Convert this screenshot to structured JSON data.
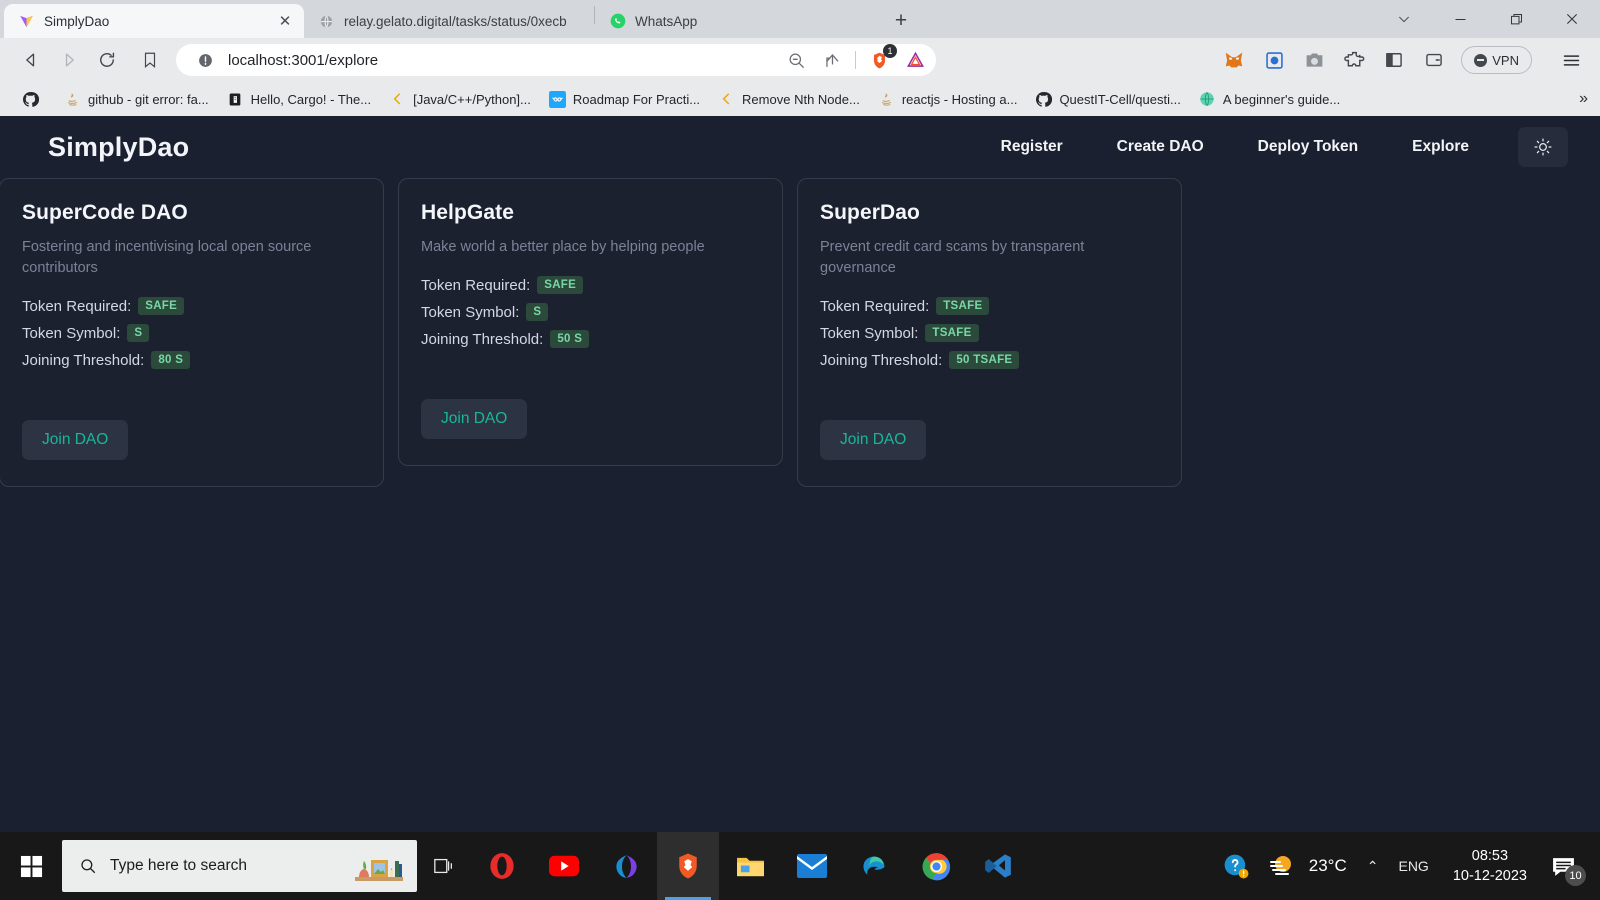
{
  "browser": {
    "tabs": [
      {
        "title": "SimplyDao",
        "icon": "vite-logo-icon",
        "active": true,
        "close_label": "✕"
      },
      {
        "title": "relay.gelato.digital/tasks/status/0xecb",
        "icon": "globe-icon",
        "active": false
      },
      {
        "title": "WhatsApp",
        "icon": "whatsapp-icon",
        "active": false
      }
    ],
    "new_tab_label": "+",
    "window_controls": {
      "tab_search": "⌄",
      "minimize": "—",
      "maximize": "❐",
      "close": "✕"
    },
    "toolbar": {
      "back": "back-arrow",
      "forward": "forward-arrow",
      "reload": "reload-arrow",
      "bookmark": "bookmark-icon",
      "url": "localhost:3001/explore",
      "site_info": "not-secure-icon",
      "zoom_out": "zoom-out-icon",
      "share": "share-icon",
      "brave_shields_count": "1",
      "vpn_label": "VPN",
      "menu": "hamburger-menu-icon"
    },
    "bookmarks": [
      {
        "label": "",
        "icon": "github-icon"
      },
      {
        "label": "github - git error: fa...",
        "icon": "java-icon"
      },
      {
        "label": "Hello, Cargo! - The...",
        "icon": "rust-book-icon"
      },
      {
        "label": "[Java/C++/Python]...",
        "icon": "leetcode-icon"
      },
      {
        "label": "Roadmap For Practi...",
        "icon": "infinity-icon"
      },
      {
        "label": "Remove Nth Node...",
        "icon": "leetcode-icon"
      },
      {
        "label": "reactjs - Hosting a...",
        "icon": "java-icon"
      },
      {
        "label": "QuestIT-Cell/questi...",
        "icon": "github-icon"
      },
      {
        "label": "A beginner's guide...",
        "icon": "globe-green-icon"
      }
    ],
    "bookmarks_overflow": "»"
  },
  "app": {
    "brand": "SimplyDao",
    "nav": [
      {
        "label": "Register"
      },
      {
        "label": "Create DAO"
      },
      {
        "label": "Deploy Token"
      },
      {
        "label": "Explore"
      }
    ],
    "theme_toggle_icon": "sun-icon",
    "labels": {
      "token_required": "Token Required:",
      "token_symbol": "Token Symbol:",
      "joining_threshold": "Joining Threshold:",
      "join_button": "Join DAO"
    },
    "cards": [
      {
        "title": "SuperCode DAO",
        "description": "Fostering and incentivising local open source contributors",
        "token_required": "SAFE",
        "token_symbol": "S",
        "joining_threshold": "80 S"
      },
      {
        "title": "HelpGate",
        "description": "Make world a better place by helping people",
        "token_required": "SAFE",
        "token_symbol": "S",
        "joining_threshold": "50 S"
      },
      {
        "title": "SuperDao",
        "description": "Prevent credit card scams by transparent governance",
        "token_required": "TSAFE",
        "token_symbol": "TSAFE",
        "joining_threshold": "50 TSAFE"
      }
    ]
  },
  "taskbar": {
    "start_icon": "windows-start-icon",
    "search_placeholder": "Type here to search",
    "search_icon": "search-icon",
    "task_view_icon": "task-view-icon",
    "apps": [
      {
        "name": "opera-icon",
        "active": false
      },
      {
        "name": "youtube-icon",
        "active": false
      },
      {
        "name": "microsoft-365-icon",
        "active": false
      },
      {
        "name": "brave-icon",
        "active": true
      },
      {
        "name": "file-explorer-icon",
        "active": false
      },
      {
        "name": "mail-icon",
        "active": false
      },
      {
        "name": "edge-icon",
        "active": false
      },
      {
        "name": "chrome-icon",
        "active": false
      },
      {
        "name": "vscode-icon",
        "active": false
      }
    ],
    "tray": {
      "help_icon": "help-icon",
      "weather_icon": "weather-sun-icon",
      "temperature": "23°C",
      "chevron": "⌃",
      "language": "ENG",
      "time": "08:53",
      "date": "10-12-2023",
      "notifications_icon": "notification-icon",
      "notifications_count": "10"
    }
  },
  "colors": {
    "page_bg": "#1b2030",
    "card_bg": "#1c2130",
    "card_border": "#343b4d",
    "accent_teal": "#17b898",
    "tag_bg": "#2b4a3c",
    "tag_text": "#79d7a6"
  }
}
